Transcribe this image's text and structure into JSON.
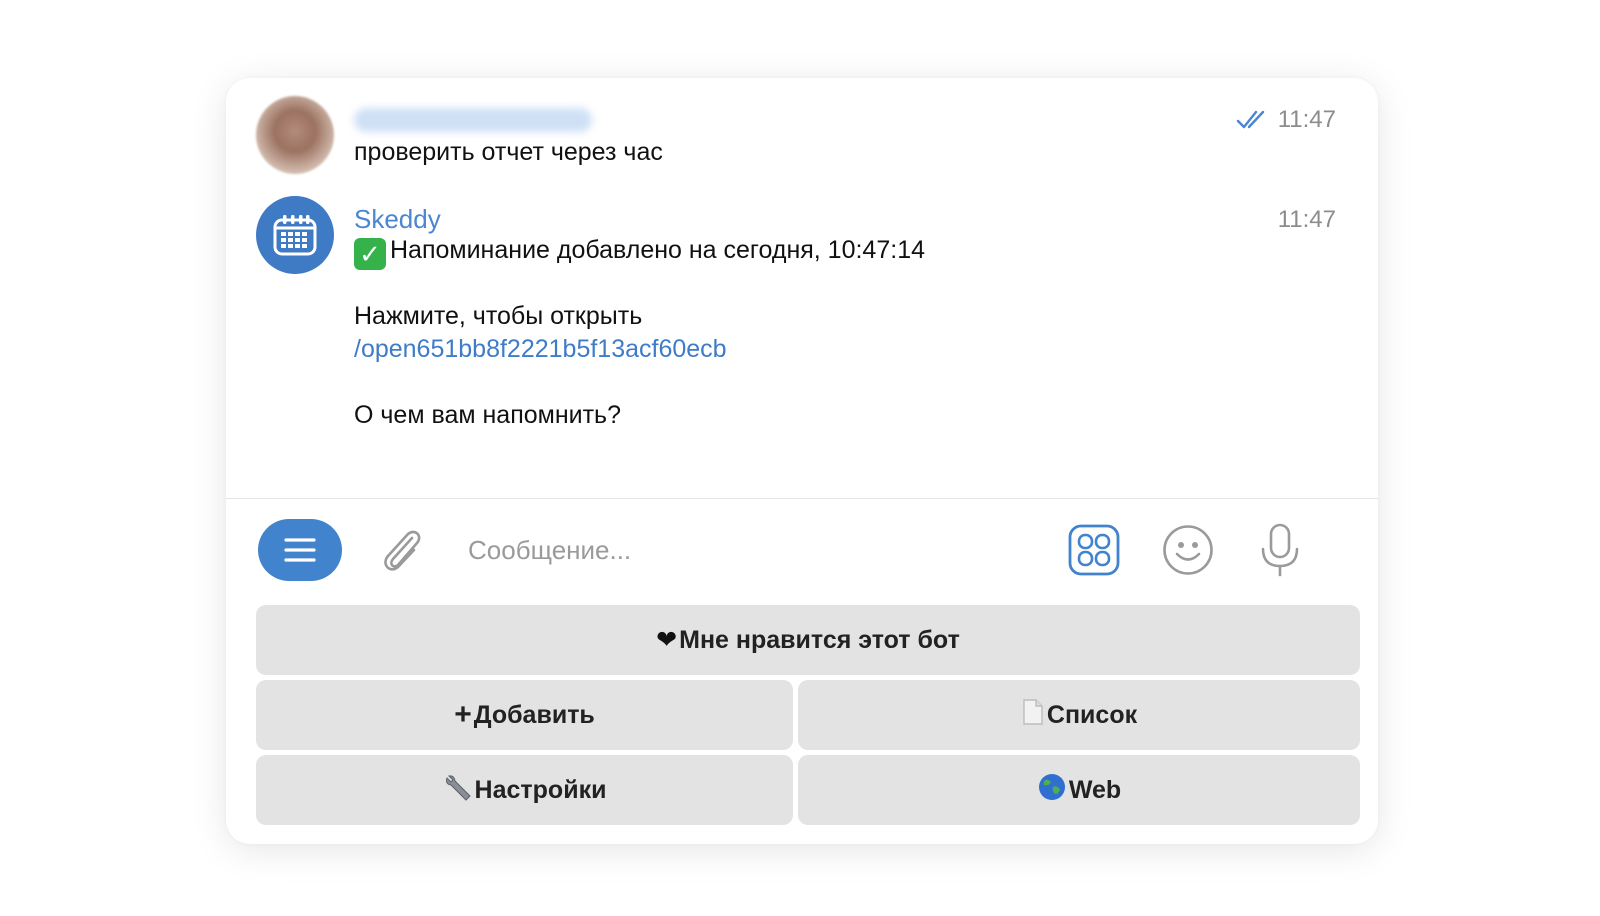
{
  "messages": [
    {
      "sender": "",
      "time": "11:47",
      "text": "проверить отчет через час"
    },
    {
      "sender": "Skeddy",
      "time": "11:47",
      "line1": "Напоминание добавлено на сегодня, 10:47:14",
      "line2": "Нажмите, чтобы открыть",
      "link": "/open651bb8f2221b5f13acf60ecb",
      "line3": "О чем вам напомнить?"
    }
  ],
  "composer": {
    "placeholder": "Сообщение..."
  },
  "keyboard": {
    "like": "Мне нравится этот бот",
    "add": "Добавить",
    "list": "Список",
    "settings": "Настройки",
    "web": "Web"
  },
  "colors": {
    "accent": "#4183cc",
    "link": "#3f7cc8",
    "button_bg": "#e3e3e3"
  },
  "icons": {
    "read_status": "double-check-icon",
    "bot_avatar": "calendar-icon",
    "menu": "menu-icon",
    "attach": "paperclip-icon",
    "apps": "apps-grid-icon",
    "emoji": "smiley-icon",
    "mic": "microphone-icon"
  }
}
